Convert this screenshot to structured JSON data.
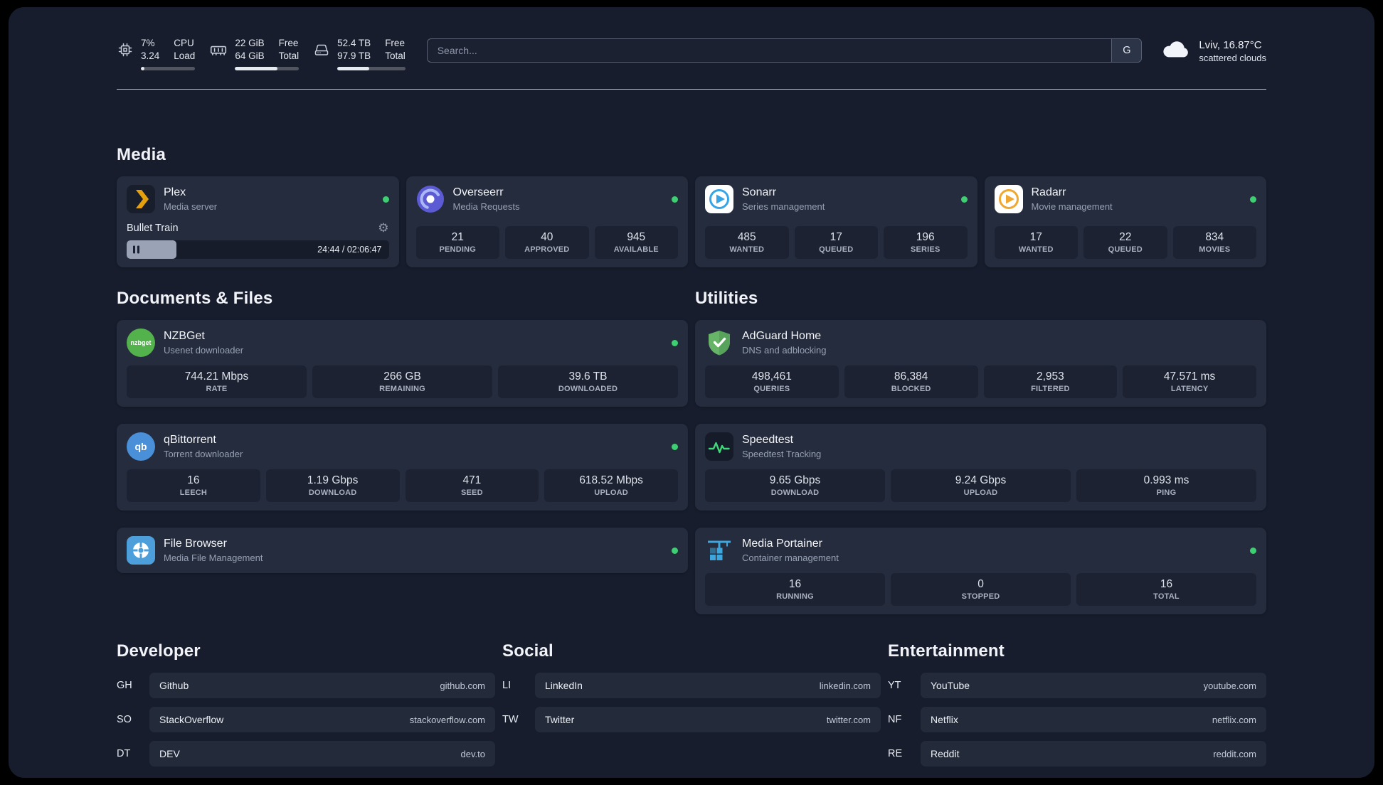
{
  "colors": {
    "dash_bg": "#171d2d",
    "card_bg": "#252c3d",
    "tile_bg": "#1c2231",
    "pill_bg": "#232a3a",
    "status_green": "#3ecf72",
    "accent_plex": "#e5a00d",
    "accent_overseerr": "#5d5bd4",
    "accent_sonarr": "#35a5e5",
    "accent_radarr": "#f0a732",
    "accent_nzbget": "#54b24c",
    "accent_qbittorrent": "#4a90d9",
    "accent_filebrowser": "#4d9fdc",
    "accent_adguard": "#67b367",
    "accent_speedtest": "#40d97a",
    "accent_portainer": "#3ca6dd"
  },
  "header": {
    "cpu": {
      "value_top": "7%",
      "value_bottom": "3.24",
      "label_top": "CPU",
      "label_bottom": "Load",
      "bar_percent": 7
    },
    "ram": {
      "value_top": "22 GiB",
      "value_bottom": "64 GiB",
      "label_top": "Free",
      "label_bottom": "Total",
      "bar_percent": 66
    },
    "disk": {
      "value_top": "52.4 TB",
      "value_bottom": "97.9 TB",
      "label_top": "Free",
      "label_bottom": "Total",
      "bar_percent": 47
    },
    "search": {
      "placeholder": "Search...",
      "engine_button": "G"
    },
    "weather": {
      "location": "Lviv, 16.87°C",
      "condition": "scattered clouds"
    }
  },
  "media": {
    "title": "Media",
    "plex": {
      "name": "Plex",
      "subtitle": "Media server",
      "now_playing": "Bullet Train",
      "time": "24:44 / 02:06:47",
      "progress_percent": 19
    },
    "overseerr": {
      "name": "Overseerr",
      "subtitle": "Media Requests",
      "stats": [
        {
          "value": "21",
          "label": "PENDING"
        },
        {
          "value": "40",
          "label": "APPROVED"
        },
        {
          "value": "945",
          "label": "AVAILABLE"
        }
      ]
    },
    "sonarr": {
      "name": "Sonarr",
      "subtitle": "Series management",
      "stats": [
        {
          "value": "485",
          "label": "WANTED"
        },
        {
          "value": "17",
          "label": "QUEUED"
        },
        {
          "value": "196",
          "label": "SERIES"
        }
      ]
    },
    "radarr": {
      "name": "Radarr",
      "subtitle": "Movie management",
      "stats": [
        {
          "value": "17",
          "label": "WANTED"
        },
        {
          "value": "22",
          "label": "QUEUED"
        },
        {
          "value": "834",
          "label": "MOVIES"
        }
      ]
    }
  },
  "documents": {
    "title": "Documents & Files",
    "nzbget": {
      "name": "NZBGet",
      "subtitle": "Usenet downloader",
      "icon_text": "nzbget",
      "stats": [
        {
          "value": "744.21 Mbps",
          "label": "RATE"
        },
        {
          "value": "266 GB",
          "label": "REMAINING"
        },
        {
          "value": "39.6 TB",
          "label": "DOWNLOADED"
        }
      ]
    },
    "qbittorrent": {
      "name": "qBittorrent",
      "subtitle": "Torrent downloader",
      "icon_text": "qb",
      "stats": [
        {
          "value": "16",
          "label": "LEECH"
        },
        {
          "value": "1.19 Gbps",
          "label": "DOWNLOAD"
        },
        {
          "value": "471",
          "label": "SEED"
        },
        {
          "value": "618.52 Mbps",
          "label": "UPLOAD"
        }
      ]
    },
    "filebrowser": {
      "name": "File Browser",
      "subtitle": "Media File Management"
    }
  },
  "utilities": {
    "title": "Utilities",
    "adguard": {
      "name": "AdGuard Home",
      "subtitle": "DNS and adblocking",
      "stats": [
        {
          "value": "498,461",
          "label": "QUERIES"
        },
        {
          "value": "86,384",
          "label": "BLOCKED"
        },
        {
          "value": "2,953",
          "label": "FILTERED"
        },
        {
          "value": "47.571 ms",
          "label": "LATENCY"
        }
      ]
    },
    "speedtest": {
      "name": "Speedtest",
      "subtitle": "Speedtest Tracking",
      "stats": [
        {
          "value": "9.65 Gbps",
          "label": "DOWNLOAD"
        },
        {
          "value": "9.24 Gbps",
          "label": "UPLOAD"
        },
        {
          "value": "0.993 ms",
          "label": "PING"
        }
      ]
    },
    "portainer": {
      "name": "Media Portainer",
      "subtitle": "Container management",
      "stats": [
        {
          "value": "16",
          "label": "RUNNING"
        },
        {
          "value": "0",
          "label": "STOPPED"
        },
        {
          "value": "16",
          "label": "TOTAL"
        }
      ]
    }
  },
  "link_sections": {
    "developer": {
      "title": "Developer",
      "links": [
        {
          "abbr": "GH",
          "name": "Github",
          "url": "github.com"
        },
        {
          "abbr": "SO",
          "name": "StackOverflow",
          "url": "stackoverflow.com"
        },
        {
          "abbr": "DT",
          "name": "DEV",
          "url": "dev.to"
        }
      ]
    },
    "social": {
      "title": "Social",
      "links": [
        {
          "abbr": "LI",
          "name": "LinkedIn",
          "url": "linkedin.com"
        },
        {
          "abbr": "TW",
          "name": "Twitter",
          "url": "twitter.com"
        }
      ]
    },
    "entertainment": {
      "title": "Entertainment",
      "links": [
        {
          "abbr": "YT",
          "name": "YouTube",
          "url": "youtube.com"
        },
        {
          "abbr": "NF",
          "name": "Netflix",
          "url": "netflix.com"
        },
        {
          "abbr": "RE",
          "name": "Reddit",
          "url": "reddit.com"
        }
      ]
    }
  }
}
